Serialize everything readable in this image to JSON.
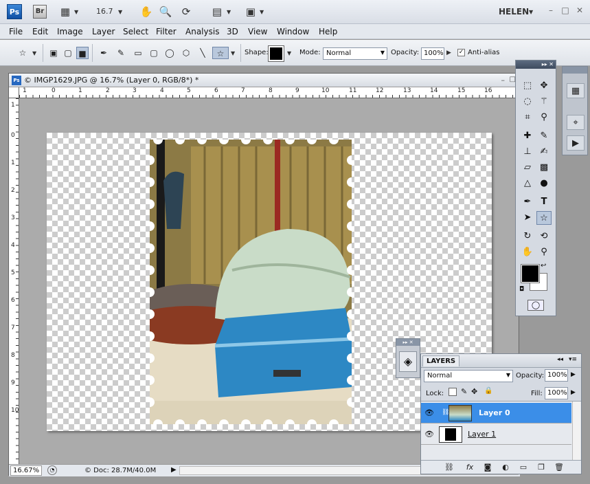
{
  "app_bar": {
    "ps_logo": "Ps",
    "br_logo": "Br",
    "zoom_value": "16.7",
    "workspace": "HELEN",
    "minimize": "–",
    "maximize": "□",
    "close": "✕"
  },
  "menu": [
    "File",
    "Edit",
    "Image",
    "Layer",
    "Select",
    "Filter",
    "Analysis",
    "3D",
    "View",
    "Window",
    "Help"
  ],
  "options": {
    "shape_label": "Shape:",
    "mode_label": "Mode:",
    "mode_value": "Normal",
    "opacity_label": "Opacity:",
    "opacity_value": "100%",
    "antialias_label": "Anti-alias",
    "antialias_checked": true
  },
  "document": {
    "title": "© IMGP1629.JPG @ 16.7% (Layer 0, RGB/8*) *",
    "h_ruler": [
      "1",
      "0",
      "1",
      "2",
      "3",
      "4",
      "5",
      "6",
      "7",
      "8",
      "9",
      "10",
      "11",
      "12",
      "13",
      "14",
      "15",
      "16"
    ],
    "v_ruler": [
      "1",
      "0",
      "1",
      "2",
      "3",
      "4",
      "5",
      "6",
      "7",
      "8",
      "9",
      "10"
    ],
    "zoom_field": "16.67%",
    "doc_info": "© Doc: 28.7M/40.0M"
  },
  "tools": {
    "collapse": "▸▸",
    "close": "✕"
  },
  "layers_panel": {
    "tab": "LAYERS",
    "blend_mode": "Normal",
    "opacity_label": "Opacity:",
    "opacity_value": "100%",
    "lock_label": "Lock:",
    "fill_label": "Fill:",
    "fill_value": "100%",
    "layers": [
      {
        "name": "Layer 0",
        "selected": true
      },
      {
        "name": "Layer 1",
        "selected": false
      }
    ]
  },
  "colors": {
    "accent": "#3b8ee8",
    "foreground": "#000000",
    "background": "#ffffff"
  }
}
